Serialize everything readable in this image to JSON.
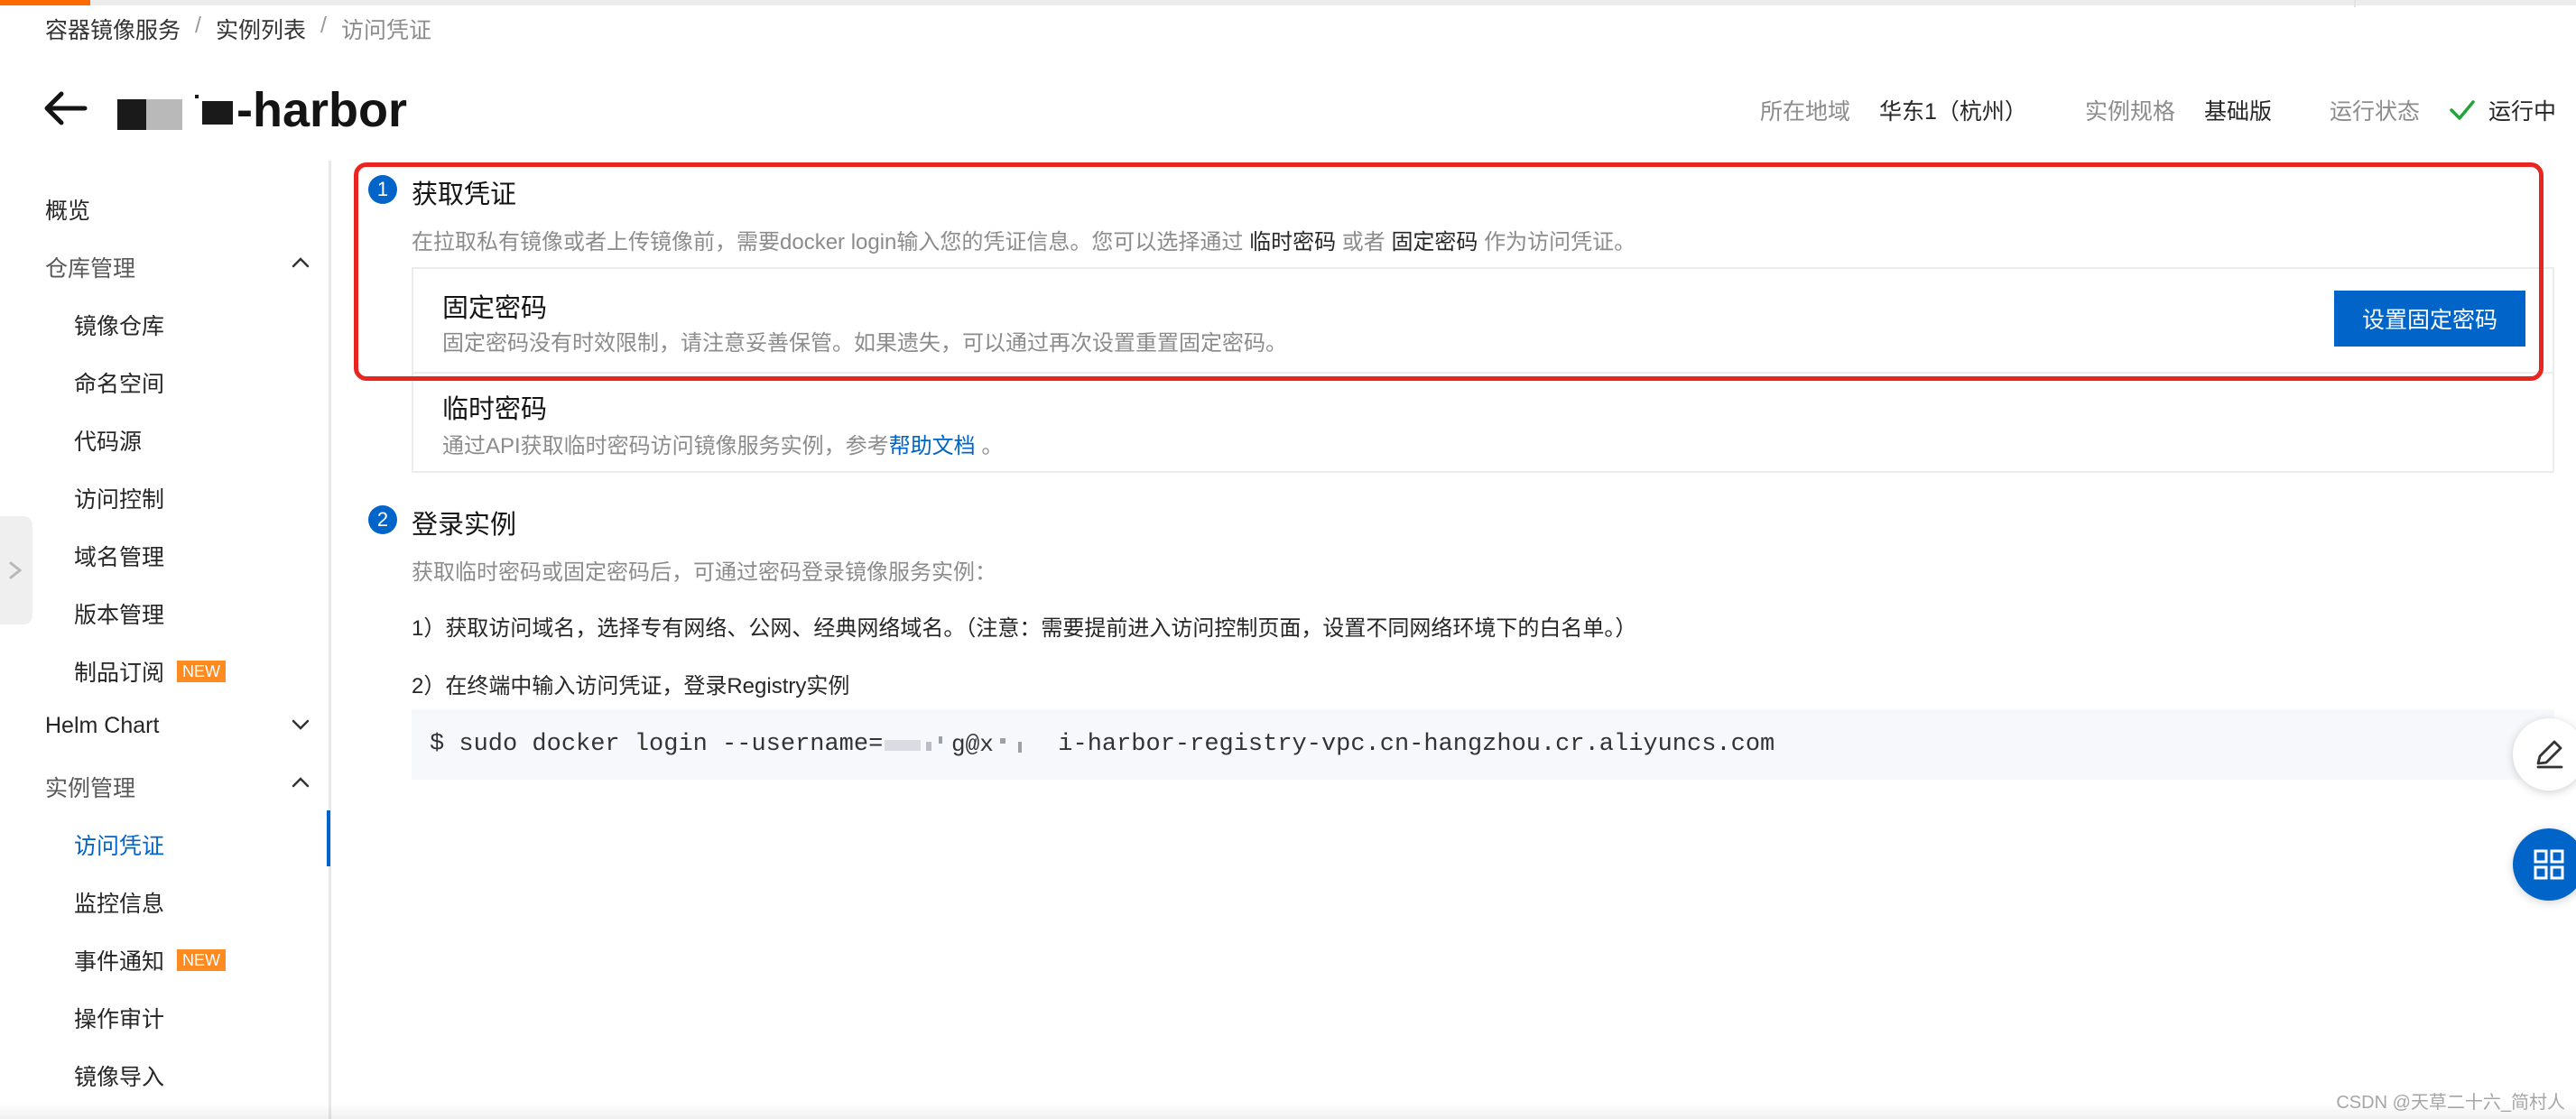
{
  "breadcrumb": {
    "items": [
      "容器镜像服务",
      "实例列表",
      "访问凭证"
    ],
    "separator": "/"
  },
  "header": {
    "title_suffix": "-harbor",
    "region_label": "所在地域",
    "region_value": "华东1（杭州）",
    "spec_label": "实例规格",
    "spec_value": "基础版",
    "status_label": "运行状态",
    "status_value": "运行中"
  },
  "sidebar": {
    "overview": "概览",
    "repo_group": "仓库管理",
    "repo_items": [
      "镜像仓库",
      "命名空间",
      "代码源",
      "访问控制",
      "域名管理",
      "版本管理",
      "制品订阅"
    ],
    "helm": "Helm Chart",
    "instance_group": "实例管理",
    "instance_items": [
      "访问凭证",
      "监控信息",
      "事件通知",
      "操作审计",
      "镜像导入"
    ],
    "new_badge": "NEW"
  },
  "step1": {
    "number": "1",
    "title": "获取凭证",
    "desc_prefix": "在拉取私有镜像或者上传镜像前，需要docker login输入您的凭证信息。您可以选择通过",
    "desc_temp": "临时密码",
    "desc_or": "或者",
    "desc_fixed": "固定密码",
    "desc_suffix": "作为访问凭证。",
    "fixed_title": "固定密码",
    "fixed_desc": "固定密码没有时效限制，请注意妥善保管。如果遗失，可以通过再次设置重置固定密码。",
    "fixed_button": "设置固定密码",
    "temp_title": "临时密码",
    "temp_desc_prefix": "通过API获取临时密码访问镜像服务实例，参考",
    "temp_desc_link": "帮助文档",
    "temp_desc_suffix": "。"
  },
  "step2": {
    "number": "2",
    "title": "登录实例",
    "desc": "获取临时密码或固定密码后，可通过密码登录镜像服务实例：",
    "instr1": "1）获取访问域名，选择专有网络、公网、经典网络域名。（注意：需要提前进入访问控制页面，设置不同网络环境下的白名单。）",
    "instr2": "2）在终端中输入访问凭证，登录Registry实例",
    "code_prefix": "$ sudo docker login --username=",
    "code_suffix": "i-harbor-registry-vpc.cn-hangzhou.cr.aliyuncs.com"
  },
  "watermark": "CSDN @天草二十六_简村人",
  "colors": {
    "primary": "#0064c8",
    "highlight": "#e8251f",
    "badge": "#ff8a1f",
    "success": "#23a33a"
  },
  "icons": [
    "back-arrow-icon",
    "check-icon",
    "chevron-up-icon",
    "chevron-down-icon",
    "edit-icon",
    "grid-icon"
  ]
}
